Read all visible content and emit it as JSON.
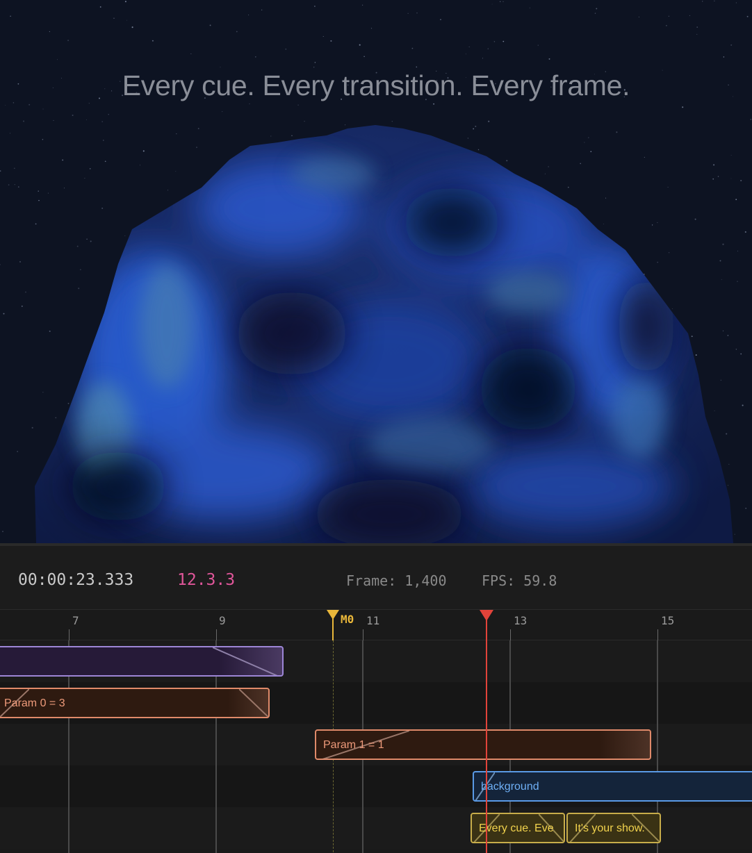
{
  "viewport": {
    "headline": "Every cue. Every transition. Every frame.",
    "colors": {
      "background": "#0d1322",
      "blob_dark": "#0a1430",
      "blob_light": "#2f6ae0"
    }
  },
  "transport": {
    "timecode": "00:00:23.333",
    "bars_beats": "12.3.3",
    "frame_label": "Frame: 1,400",
    "fps_label": "FPS: 59.8"
  },
  "ruler": {
    "ticks": [
      "7",
      "9",
      "11",
      "13",
      "15"
    ]
  },
  "marker": {
    "label": "M0",
    "color": "#e9b73a"
  },
  "playhead": {
    "color": "#e2433a"
  },
  "clips": {
    "purple": {
      "label": ""
    },
    "param0": {
      "label": "Param 0 = 3"
    },
    "param1": {
      "label": "Param 1 = 1"
    },
    "background": {
      "label": "background"
    },
    "text1": {
      "label": "Every cue. Eve"
    },
    "text2": {
      "label": "It's your show."
    }
  }
}
